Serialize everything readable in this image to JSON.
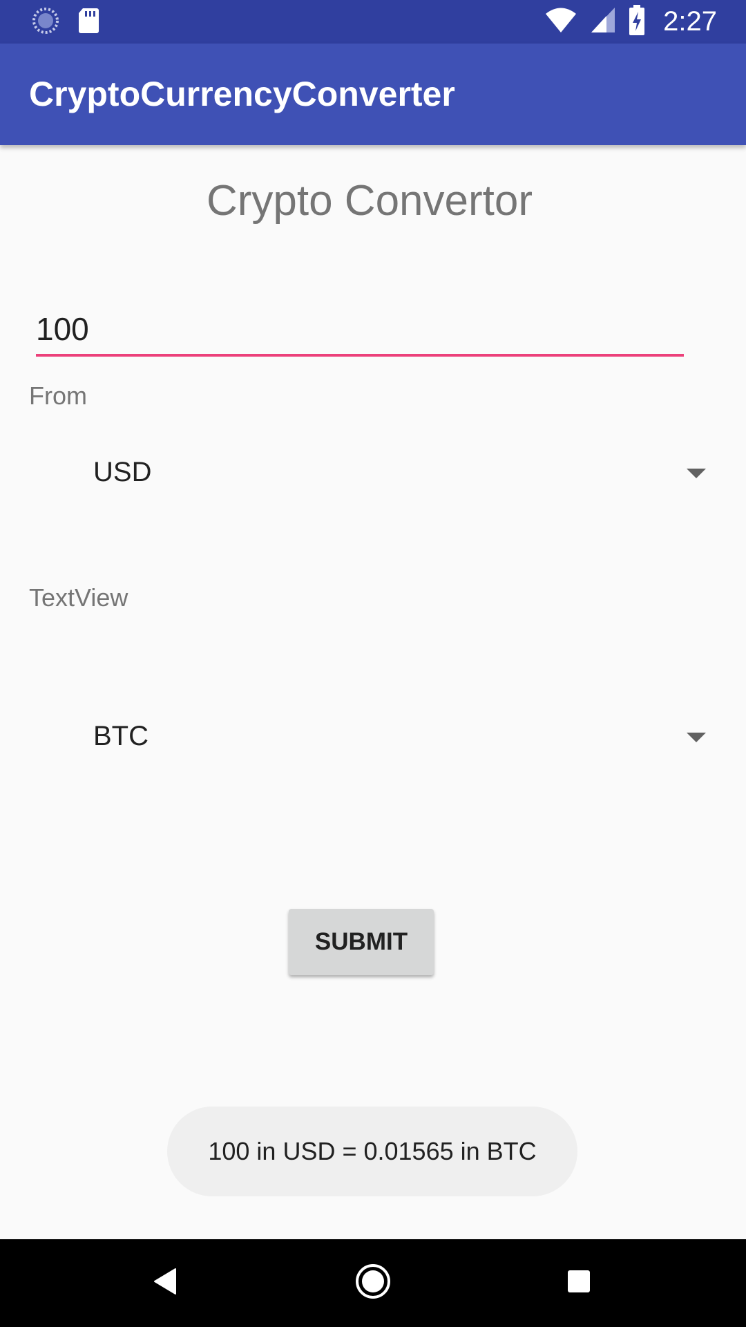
{
  "status_bar": {
    "time": "2:27",
    "icons": [
      "sync-icon",
      "sd-card-icon",
      "wifi-icon",
      "signal-icon",
      "battery-charging-icon"
    ],
    "color": "#303f9f"
  },
  "app_bar": {
    "title": "CryptoCurrencyConverter",
    "color": "#3f51b5"
  },
  "main": {
    "heading": "Crypto Convertor",
    "amount_value": "100",
    "from_label": "From",
    "from_currency": "USD",
    "to_label": "TextView",
    "to_currency": "BTC",
    "submit_label": "SUBMIT",
    "accent_color": "#ec407a"
  },
  "toast": {
    "message": "100 in USD = 0.01565 in BTC"
  },
  "nav_bar": {
    "icons": [
      "back-icon",
      "home-icon",
      "recents-icon"
    ]
  }
}
